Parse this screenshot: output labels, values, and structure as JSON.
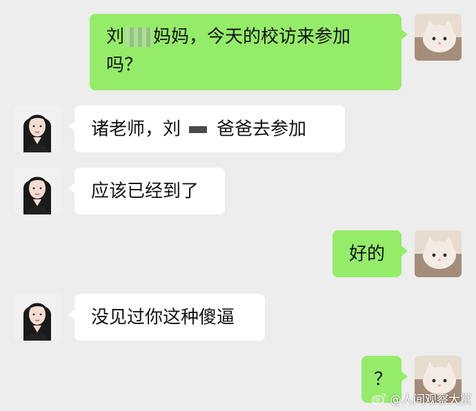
{
  "messages": [
    {
      "from": "me",
      "parts": [
        "刘",
        "妈妈，今天的校访来参加",
        "吗？"
      ]
    },
    {
      "from": "them",
      "parts": [
        "诸老师，刘",
        "爸爸去参加"
      ]
    },
    {
      "from": "them",
      "text": "应该已经到了"
    },
    {
      "from": "me",
      "text": "好的"
    },
    {
      "from": "them",
      "text": "没见过你这种傻逼"
    },
    {
      "from": "me",
      "text": "？"
    }
  ],
  "watermark": {
    "text": "@人间观察大赏",
    "icon": "weibo-icon"
  },
  "colors": {
    "background": "#ededed",
    "my_bubble": "#95ec69",
    "their_bubble": "#ffffff"
  },
  "avatars": {
    "me": "cat-avatar",
    "them": "woman-avatar"
  }
}
